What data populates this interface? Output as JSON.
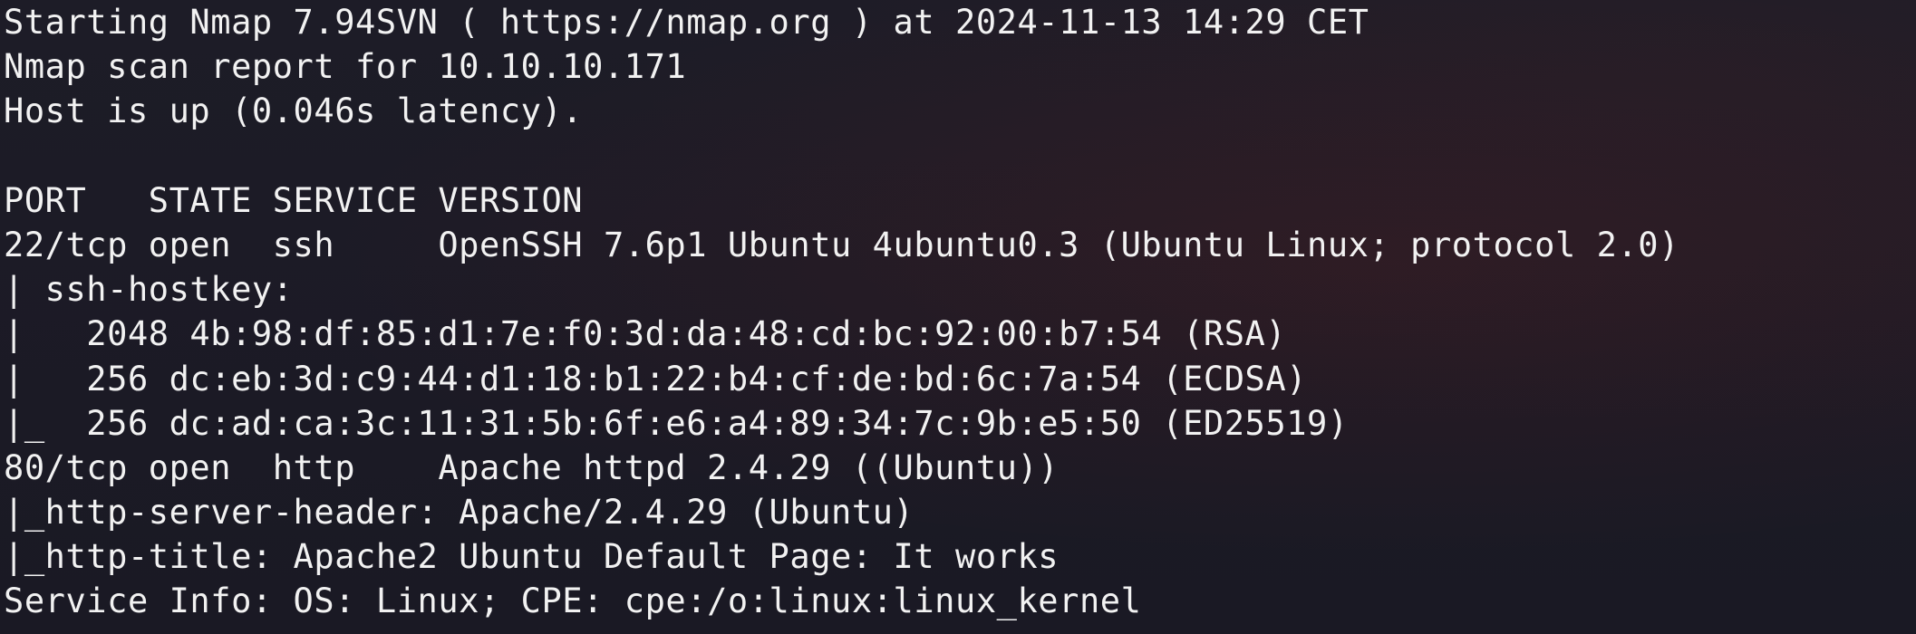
{
  "terminal": {
    "background_color": "#1c1b26",
    "text_color": "#f2f2f2",
    "lines": [
      "Starting Nmap 7.94SVN ( https://nmap.org ) at 2024-11-13 14:29 CET",
      "Nmap scan report for 10.10.10.171",
      "Host is up (0.046s latency).",
      "",
      "PORT   STATE SERVICE VERSION",
      "22/tcp open  ssh     OpenSSH 7.6p1 Ubuntu 4ubuntu0.3 (Ubuntu Linux; protocol 2.0)",
      "| ssh-hostkey: ",
      "|   2048 4b:98:df:85:d1:7e:f0:3d:da:48:cd:bc:92:00:b7:54 (RSA)",
      "|   256 dc:eb:3d:c9:44:d1:18:b1:22:b4:cf:de:bd:6c:7a:54 (ECDSA)",
      "|_  256 dc:ad:ca:3c:11:31:5b:6f:e6:a4:89:34:7c:9b:e5:50 (ED25519)",
      "80/tcp open  http    Apache httpd 2.4.29 ((Ubuntu))",
      "|_http-server-header: Apache/2.4.29 (Ubuntu)",
      "|_http-title: Apache2 Ubuntu Default Page: It works",
      "Service Info: OS: Linux; CPE: cpe:/o:linux:linux_kernel"
    ]
  }
}
